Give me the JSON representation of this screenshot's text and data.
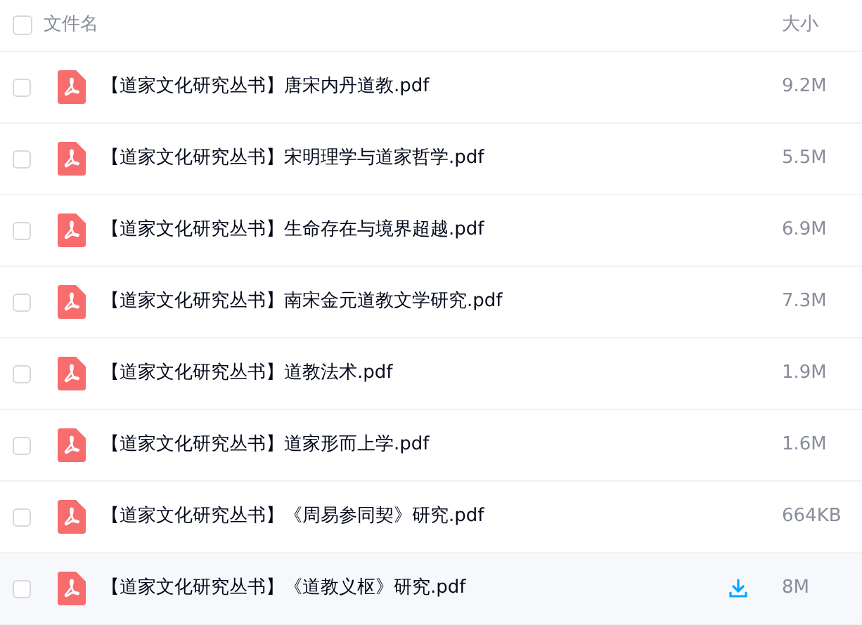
{
  "header": {
    "select_all": {
      "checked": false
    },
    "columns": [
      "文件名",
      "大小"
    ]
  },
  "files": [
    {
      "name": "【道家文化研究丛书】唐宋内丹道教.pdf",
      "size": "9.2M",
      "checked": false,
      "hovered": false
    },
    {
      "name": "【道家文化研究丛书】宋明理学与道家哲学.pdf",
      "size": "5.5M",
      "checked": false,
      "hovered": false
    },
    {
      "name": "【道家文化研究丛书】生命存在与境界超越.pdf",
      "size": "6.9M",
      "checked": false,
      "hovered": false
    },
    {
      "name": "【道家文化研究丛书】南宋金元道教文学研究.pdf",
      "size": "7.3M",
      "checked": false,
      "hovered": false
    },
    {
      "name": "【道家文化研究丛书】道教法术.pdf",
      "size": "1.9M",
      "checked": false,
      "hovered": false
    },
    {
      "name": "【道家文化研究丛书】道家形而上学.pdf",
      "size": "1.6M",
      "checked": false,
      "hovered": false
    },
    {
      "name": "【道家文化研究丛书】《周易参同契》研究.pdf",
      "size": "664KB",
      "checked": false,
      "hovered": false
    },
    {
      "name": "【道家文化研究丛书】《道教义枢》研究.pdf",
      "size": "8M",
      "checked": false,
      "hovered": true
    }
  ]
}
